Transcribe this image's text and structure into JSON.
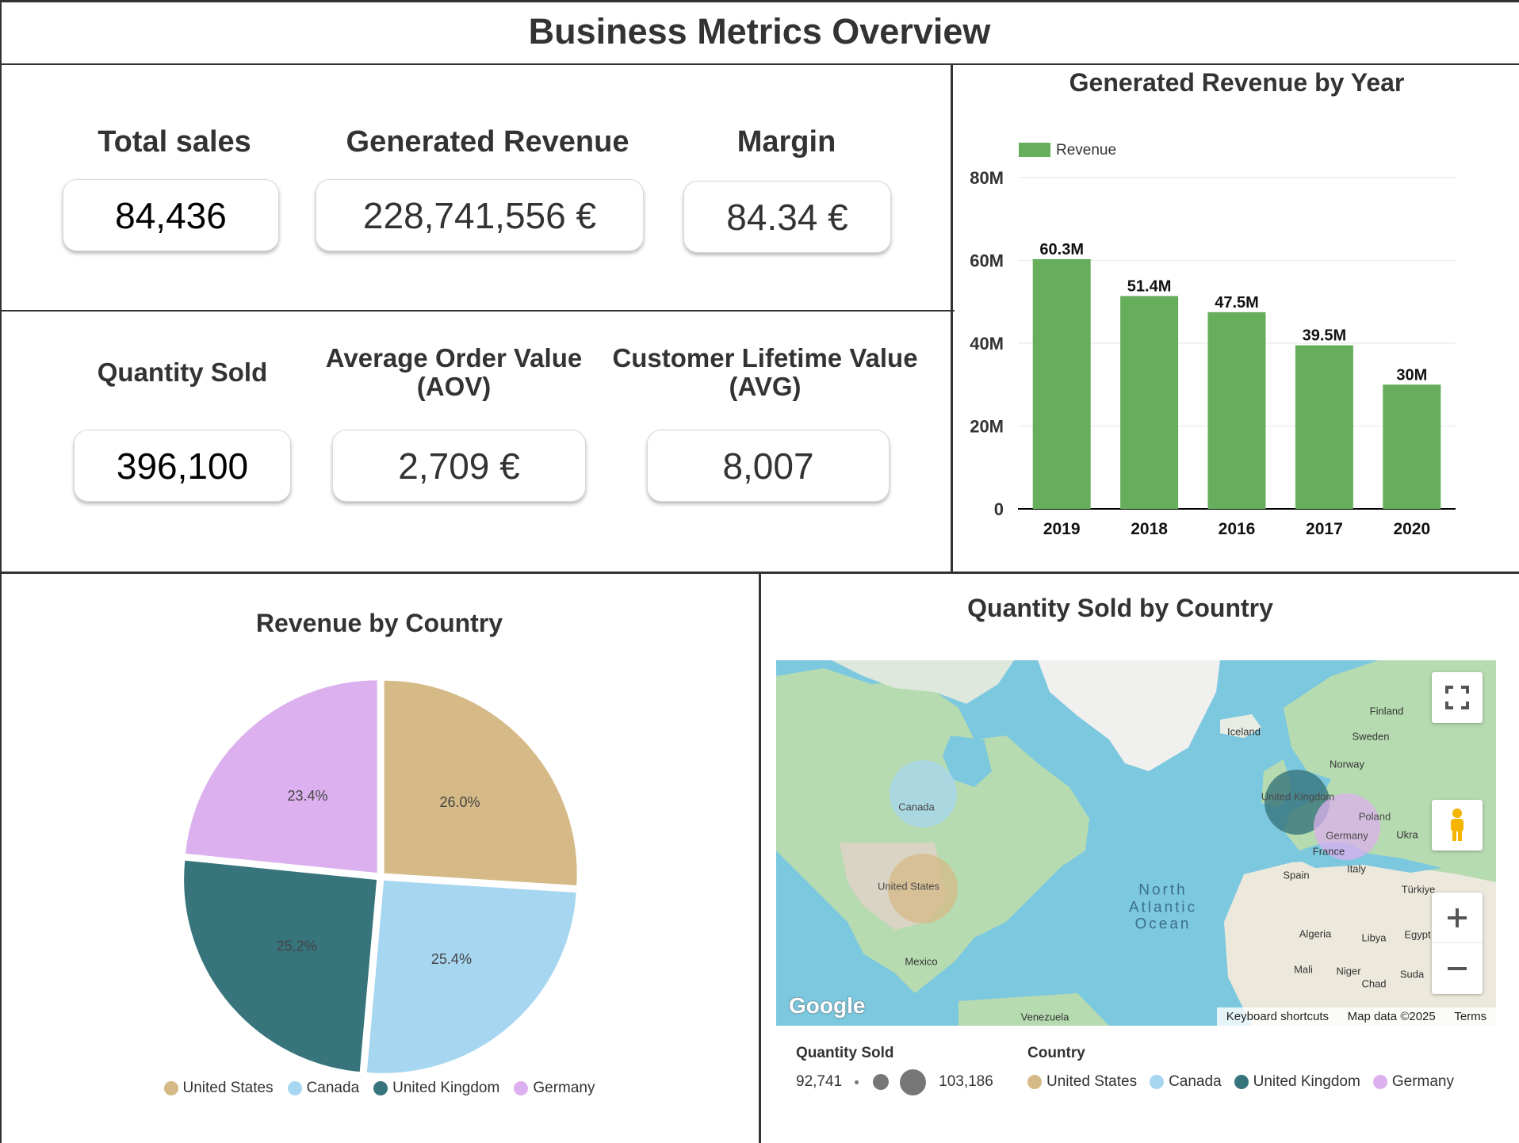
{
  "page": {
    "title": "Business Metrics Overview"
  },
  "kpis": {
    "total_sales": {
      "label": "Total sales",
      "value": "84,436"
    },
    "generated_revenue": {
      "label": "Generated Revenue",
      "value": "228,741,556 €"
    },
    "margin": {
      "label": "Margin",
      "value": "84.34 €"
    },
    "quantity_sold": {
      "label": "Quantity Sold",
      "value": "396,100"
    },
    "aov": {
      "label_line1": "Average Order Value",
      "label_line2": "(AOV)",
      "value": "2,709 €"
    },
    "clv": {
      "label_line1": "Customer Lifetime Value",
      "label_line2": "(AVG)",
      "value": "8,007"
    }
  },
  "colors": {
    "bar": "#66ad5c",
    "united_states": "#d5b987",
    "canada": "#a6d6f0",
    "united_kingdom": "#37747b",
    "germany": "#dcb0ee"
  },
  "chart_data": [
    {
      "type": "bar",
      "title": "Generated Revenue by Year",
      "categories": [
        "2019",
        "2018",
        "2016",
        "2017",
        "2020"
      ],
      "series": [
        {
          "name": "Revenue",
          "values": [
            60.3,
            51.4,
            47.5,
            39.5,
            30
          ],
          "labels": [
            "60.3M",
            "51.4M",
            "47.5M",
            "39.5M",
            "30M"
          ]
        }
      ],
      "ylim": [
        0,
        80
      ],
      "yticks": [
        "0",
        "20M",
        "40M",
        "60M",
        "80M"
      ],
      "grid": true,
      "legend": "top-left"
    },
    {
      "type": "pie",
      "title": "Revenue by Country",
      "categories": [
        "United States",
        "Canada",
        "United Kingdom",
        "Germany"
      ],
      "values": [
        26.0,
        25.4,
        25.2,
        23.4
      ],
      "labels": [
        "26.0%",
        "25.4%",
        "25.2%",
        "23.4%"
      ],
      "legend": "bottom"
    },
    {
      "type": "bubble-map",
      "title": "Quantity Sold by Country",
      "categories": [
        "United States",
        "Canada",
        "United Kingdom",
        "Germany"
      ],
      "size_legend_title": "Quantity Sold",
      "size_min": "92,741",
      "size_max": "103,186",
      "color_legend_title": "Country"
    }
  ],
  "map": {
    "labels": {
      "canada": "Canada",
      "united_states": "United States",
      "mexico": "Mexico",
      "venezuela": "Venezuela",
      "iceland": "Iceland",
      "finland": "Finland",
      "sweden": "Sweden",
      "norway": "Norway",
      "united_kingdom": "United Kingdom",
      "poland": "Poland",
      "germany": "Germany",
      "ukraine": "Ukra",
      "france": "France",
      "spain": "Spain",
      "italy": "Italy",
      "turkiye": "Türkiye",
      "algeria": "Algeria",
      "libya": "Libya",
      "egypt": "Egypt",
      "mali": "Mali",
      "niger": "Niger",
      "chad": "Chad",
      "sudan": "Suda",
      "ocean_1": "North",
      "ocean_2": "Atlantic",
      "ocean_3": "Ocean"
    },
    "logo": "Google",
    "footer": {
      "shortcuts": "Keyboard shortcuts",
      "map_data": "Map data ©2025",
      "terms": "Terms"
    }
  }
}
